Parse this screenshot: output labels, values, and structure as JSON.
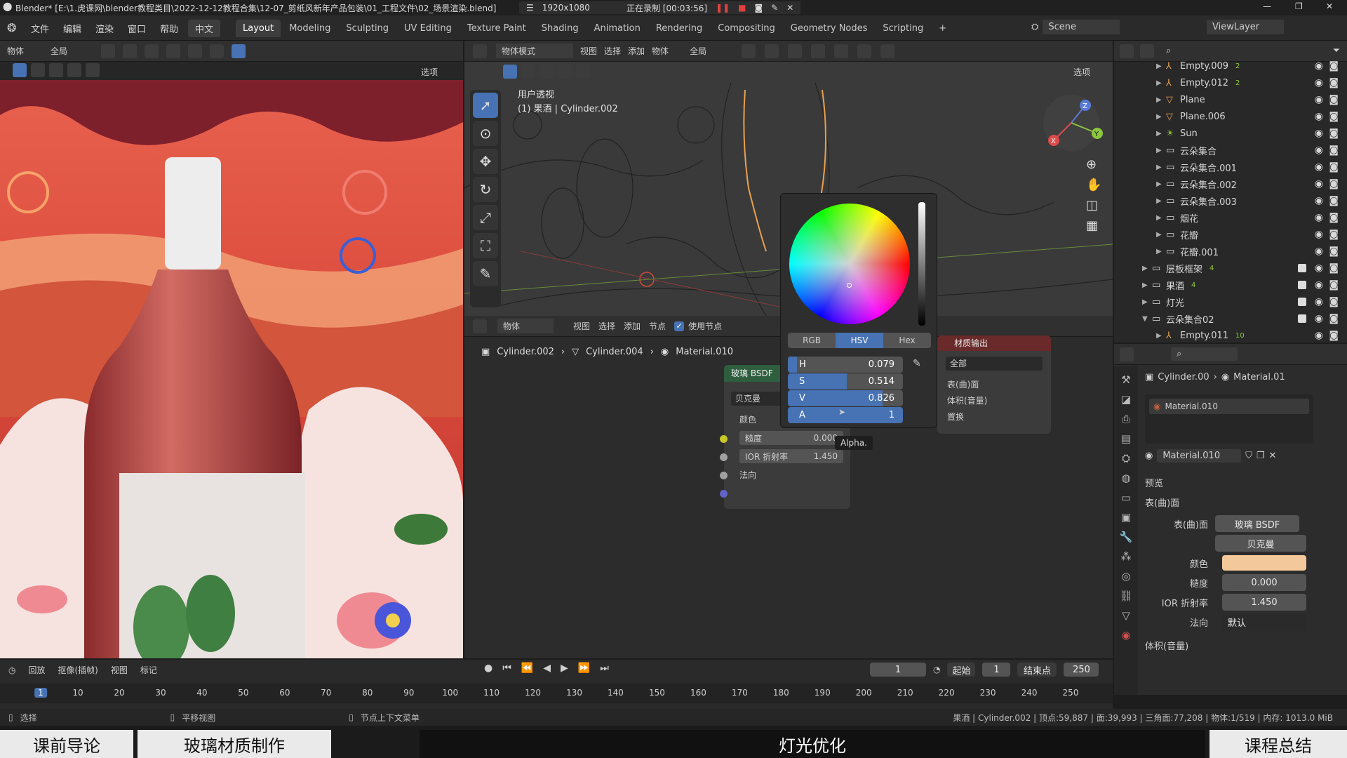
{
  "titlebar": {
    "title": "Blender* [E:\\1.虎课网\\blender教程类目\\2022-12-12教程合集\\12-07_剪纸风新年产品包装\\01_工程文件\\02_场景渲染.blend]",
    "resolution": "1920x1080",
    "recording": "正在录制 [00:03:56]"
  },
  "menu": [
    "文件",
    "编辑",
    "渲染",
    "窗口",
    "帮助"
  ],
  "lang": "中文",
  "workspaces": [
    "Layout",
    "Modeling",
    "Sculpting",
    "UV Editing",
    "Texture Paint",
    "Shading",
    "Animation",
    "Rendering",
    "Compositing",
    "Geometry Nodes",
    "Scripting"
  ],
  "scene": "Scene",
  "view_layer": "ViewLayer",
  "left_header": {
    "mode": "物体",
    "global": "全局",
    "options": "选项"
  },
  "vp_header": {
    "mode": "物体模式",
    "menus": [
      "视图",
      "选择",
      "添加",
      "物体"
    ],
    "global": "全局",
    "options": "选项"
  },
  "viewport": {
    "label1": "用户透视",
    "label2": "(1) 果酒 | Cylinder.002"
  },
  "node_header": {
    "mode": "物体",
    "menus": [
      "视图",
      "选择",
      "添加",
      "节点"
    ],
    "use_nodes": "使用节点"
  },
  "breadcrumb": {
    "obj": "Cylinder.002",
    "mesh": "Cylinder.004",
    "mat": "Material.010"
  },
  "bsdf": {
    "title": "玻璃 BSDF",
    "dist": "贝克曼",
    "color": "颜色",
    "rough_label": "糙度",
    "rough": "0.000",
    "ior_label": "IOR 折射率",
    "ior": "1.450",
    "normal": "法向"
  },
  "output": {
    "title": "材质输出",
    "target": "全部",
    "surface": "表(曲)面",
    "volume": "体积(音量)",
    "disp": "置换"
  },
  "picker": {
    "tabs": [
      "RGB",
      "HSV",
      "Hex"
    ],
    "h": "0.079",
    "s": "0.514",
    "v": "0.826",
    "a": "1",
    "h_frac": 0.079,
    "s_frac": 0.514,
    "v_frac": 0.826,
    "a_frac": 1,
    "tooltip": "Alpha."
  },
  "outliner": [
    {
      "name": "Empty.009",
      "kind": "empty",
      "extra": "2"
    },
    {
      "name": "Empty.012",
      "kind": "empty",
      "extra": "2"
    },
    {
      "name": "Plane",
      "kind": "mesh",
      "extra": ""
    },
    {
      "name": "Plane.006",
      "kind": "mesh",
      "extra": ""
    },
    {
      "name": "Sun",
      "kind": "light",
      "extra": ""
    },
    {
      "name": "云朵集合",
      "kind": "coll",
      "extra": ""
    },
    {
      "name": "云朵集合.001",
      "kind": "coll",
      "extra": ""
    },
    {
      "name": "云朵集合.002",
      "kind": "coll",
      "extra": ""
    },
    {
      "name": "云朵集合.003",
      "kind": "coll",
      "extra": ""
    },
    {
      "name": "烟花",
      "kind": "coll",
      "extra": ""
    },
    {
      "name": "花瓣",
      "kind": "coll",
      "extra": ""
    },
    {
      "name": "花瓣.001",
      "kind": "coll",
      "extra": ""
    },
    {
      "name": "层板框架",
      "kind": "coll2",
      "extra": "4"
    },
    {
      "name": "果酒",
      "kind": "coll2",
      "extra": "4"
    },
    {
      "name": "灯光",
      "kind": "coll2",
      "extra": ""
    },
    {
      "name": "云朵集合02",
      "kind": "coll2",
      "extra": ""
    },
    {
      "name": "Empty.011",
      "kind": "empty",
      "extra": "10"
    }
  ],
  "props": {
    "obj": "Cylinder.00",
    "mat": "Material.01",
    "slot": "Material.010",
    "mat_name": "Material.010",
    "preview": "预览",
    "surface_sec": "表(曲)面",
    "surface_label": "表(曲)面",
    "surface_val": "玻璃 BSDF",
    "dist": "贝克曼",
    "color_label": "颜色",
    "rough_label": "糙度",
    "rough": "0.000",
    "ior_label": "IOR 折射率",
    "ior": "1.450",
    "normal_label": "法向",
    "normal": "默认",
    "volume": "体积(音量)"
  },
  "timeline": {
    "playback": "回放",
    "keying": "抠像(插帧)",
    "view": "视图",
    "marker": "标记",
    "frame": "1",
    "start_label": "起始",
    "start": "1",
    "end_label": "结束点",
    "end": "250",
    "ticks": [
      "1",
      "10",
      "20",
      "30",
      "40",
      "50",
      "60",
      "70",
      "80",
      "90",
      "100",
      "110",
      "120",
      "130",
      "140",
      "150",
      "160",
      "170",
      "180",
      "190",
      "200",
      "210",
      "220",
      "230",
      "240",
      "250"
    ]
  },
  "status": {
    "select": "选择",
    "pan": "平移视图",
    "ctx": "节点上下文菜单",
    "info": "果酒 | Cylinder.002 | 顶点:59,887 | 面:39,993 | 三角面:77,208 | 物体:1/519 | 内存: 1013.0 MiB"
  },
  "course": [
    "课前导论",
    "玻璃材质制作",
    "灯光优化",
    "课程总结"
  ],
  "colors": {
    "accent": "#4772b3",
    "base_color": "#f3c89a"
  }
}
